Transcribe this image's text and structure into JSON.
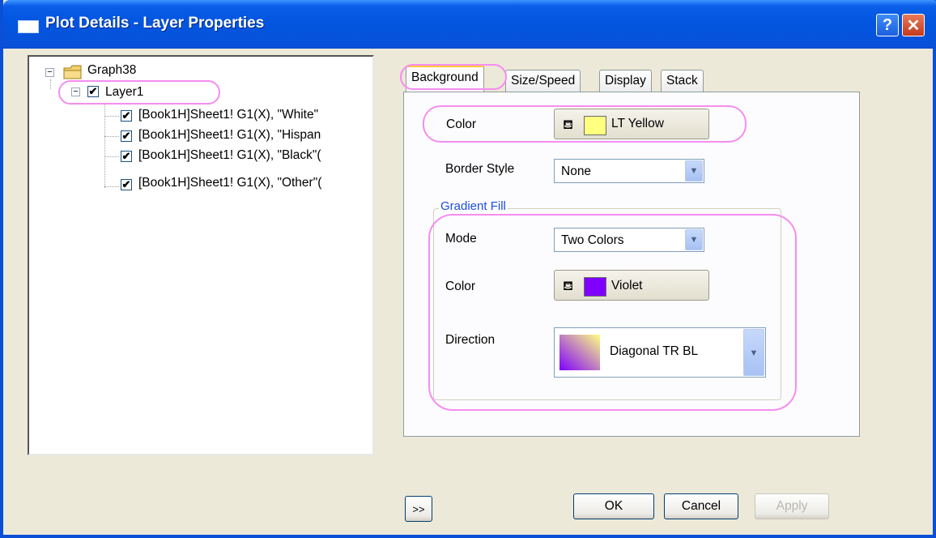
{
  "window": {
    "title": "Plot Details - Layer Properties",
    "help_label": "?",
    "close_label": "✕"
  },
  "tree": {
    "root": "Graph38",
    "layer": "Layer1",
    "datasets": [
      "[Book1H]Sheet1! G1(X), \"White\"",
      "[Book1H]Sheet1! G1(X), \"Hispan",
      "[Book1H]Sheet1! G1(X), \"Black\"(",
      "[Book1H]Sheet1! G1(X), \"Other\"("
    ]
  },
  "tabs": [
    "Background",
    "Size/Speed",
    "Display",
    "Stack"
  ],
  "background": {
    "color_label": "Color",
    "color_value": "LT Yellow",
    "color_hex": "#ffff80",
    "border_style_label": "Border Style",
    "border_style_value": "None",
    "gradient_title": "Gradient Fill",
    "mode_label": "Mode",
    "mode_value": "Two Colors",
    "gradient_color_label": "Color",
    "gradient_color_value": "Violet",
    "gradient_color_hex": "#8000ff",
    "direction_label": "Direction",
    "direction_value": "Diagonal TR BL"
  },
  "buttons": {
    "expand": ">>",
    "ok": "OK",
    "cancel": "Cancel",
    "apply": "Apply"
  },
  "colors": {
    "accent_highlight": "#f58df0",
    "titlebar": "#0553dc"
  }
}
